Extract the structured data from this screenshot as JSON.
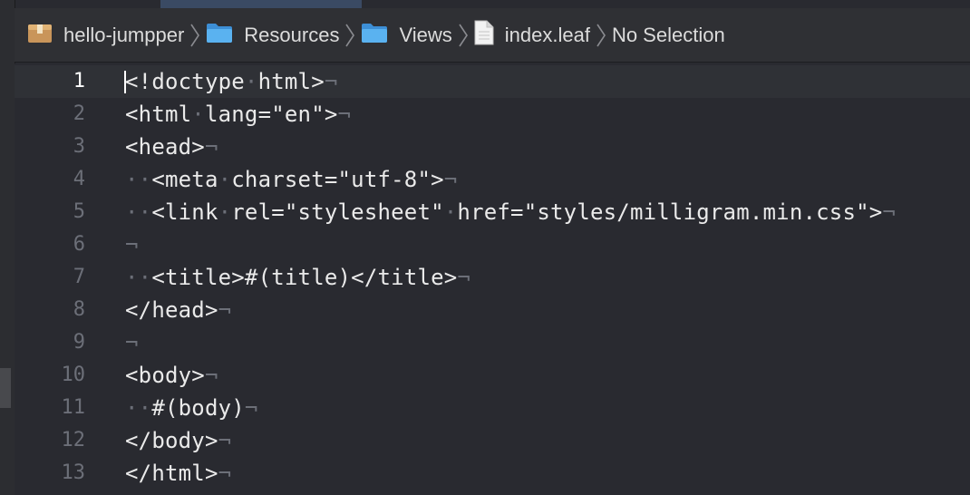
{
  "breadcrumb": {
    "items": [
      {
        "label": "hello-jumpper",
        "icon": "package-icon"
      },
      {
        "label": "Resources",
        "icon": "folder-icon"
      },
      {
        "label": "Views",
        "icon": "folder-icon"
      },
      {
        "label": "index.leaf",
        "icon": "document-icon"
      }
    ],
    "tail": "No Selection"
  },
  "editor": {
    "current_line": 1,
    "lines": [
      {
        "number": "1",
        "text": "<!doctype·html>¬"
      },
      {
        "number": "2",
        "text": "<html·lang=\"en\">¬"
      },
      {
        "number": "3",
        "text": "<head>¬"
      },
      {
        "number": "4",
        "text": "··<meta·charset=\"utf-8\">¬"
      },
      {
        "number": "5",
        "text": "··<link·rel=\"stylesheet\"·href=\"styles/milligram.min.css\">¬"
      },
      {
        "number": "6",
        "text": "¬"
      },
      {
        "number": "7",
        "text": "··<title>#(title)</title>¬"
      },
      {
        "number": "8",
        "text": "</head>¬"
      },
      {
        "number": "9",
        "text": "¬"
      },
      {
        "number": "10",
        "text": "<body>¬"
      },
      {
        "number": "11",
        "text": "··#(body)¬"
      },
      {
        "number": "12",
        "text": "</body>¬"
      },
      {
        "number": "13",
        "text": "</html>¬"
      }
    ]
  },
  "colors": {
    "background": "#292a30",
    "current_line": "#2f3136",
    "folder": "#4aa3e6",
    "package": "#d9a866",
    "invisible": "#6c6f78"
  }
}
